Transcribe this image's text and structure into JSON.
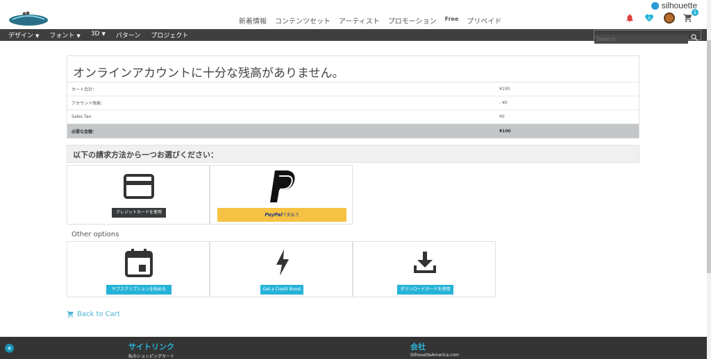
{
  "brand": {
    "name": "silhouette"
  },
  "top_nav": [
    {
      "label": "新着情報"
    },
    {
      "label": "コンテンツセット"
    },
    {
      "label": "アーティスト"
    },
    {
      "label": "プロモーション"
    },
    {
      "label": "Free"
    },
    {
      "label": "プリペイド"
    }
  ],
  "top_icons": {
    "notifications": {
      "icon": "bell-icon",
      "color": "#e0403c"
    },
    "favorites": {
      "icon": "heart-icon",
      "badge": "0"
    },
    "cart": {
      "icon": "cart-icon",
      "badge": "1"
    }
  },
  "category_nav": [
    {
      "label": "デザイン",
      "has_dropdown": true
    },
    {
      "label": "フォント",
      "has_dropdown": true
    },
    {
      "label": "3D",
      "has_dropdown": true
    },
    {
      "label": "パターン",
      "has_dropdown": false
    },
    {
      "label": "プロジェクト",
      "has_dropdown": false
    }
  ],
  "search": {
    "placeholder": "Search"
  },
  "balance": {
    "heading": "オンラインアカウントに十分な残高がありません。",
    "rows": [
      {
        "label": "カート合計：",
        "value": "¥100"
      },
      {
        "label": "アカウント残高：",
        "value": "- ¥0"
      },
      {
        "label": "Sales Tax:",
        "value": "¥0"
      }
    ],
    "total": {
      "label": "必要な金額：",
      "value": "¥100"
    }
  },
  "payment": {
    "title": "以下の請求方法から一つお選びください：",
    "methods": [
      {
        "icon": "credit-card-icon",
        "button": "クレジットカードを使用"
      },
      {
        "icon": "paypal-icon",
        "button_brand": "PayPal",
        "button_suffix": "で支払う"
      }
    ]
  },
  "other_options": {
    "title": "Other options",
    "options": [
      {
        "icon": "calendar-icon",
        "button": "サブスクリプションを始める"
      },
      {
        "icon": "lightning-icon",
        "button": "Get a Credit Boost"
      },
      {
        "icon": "download-icon",
        "button": "ダウンロードカードを使用"
      }
    ]
  },
  "back_link": {
    "label": "Back to Cart"
  },
  "footer": {
    "col1": {
      "heading": "サイトリンク",
      "link": "私のショッピングカート"
    },
    "col2": {
      "heading": "会社",
      "link": "SilhouetteAmerica.com"
    }
  },
  "colors": {
    "accent": "#26b3d8",
    "nav_bg": "#3f3f3f",
    "footer_bg": "#343434",
    "paypal_button": "#f6c244"
  }
}
